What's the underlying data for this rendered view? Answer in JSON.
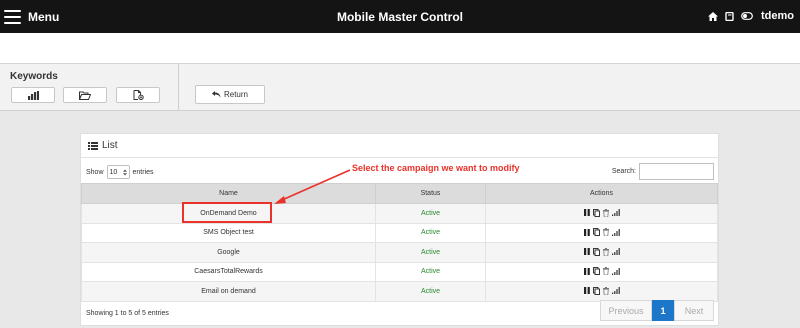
{
  "header": {
    "menu_label": "Menu",
    "title": "Mobile Master Control",
    "user": "tdemo",
    "icons": [
      "home-icon",
      "book-icon",
      "toggle-icon"
    ]
  },
  "toolbar": {
    "section_label": "Keywords",
    "buttons": [
      "stats-icon",
      "folder-open-icon",
      "new-file-icon"
    ],
    "return_label": "Return"
  },
  "list": {
    "title": "List",
    "show_label": "Show",
    "show_value": "10",
    "entries_label": "entries",
    "search_label": "Search:",
    "columns": [
      "Name",
      "Status",
      "Actions"
    ],
    "rows": [
      {
        "name": "OnDemand Demo",
        "status": "Active"
      },
      {
        "name": "SMS Object test",
        "status": "Active"
      },
      {
        "name": "Google",
        "status": "Active"
      },
      {
        "name": "CaesarsTotalRewards",
        "status": "Active"
      },
      {
        "name": "Email on demand",
        "status": "Active"
      }
    ],
    "info": "Showing 1 to 5 of 5 entries",
    "pagination": {
      "previous": "Previous",
      "page": "1",
      "next": "Next"
    }
  },
  "annotation": {
    "text": "Select the campaign we want to modify",
    "color": "#e8322a"
  },
  "colors": {
    "topbar": "#141414",
    "status_active": "#2a8a2a",
    "page_active": "#1d76c8"
  }
}
